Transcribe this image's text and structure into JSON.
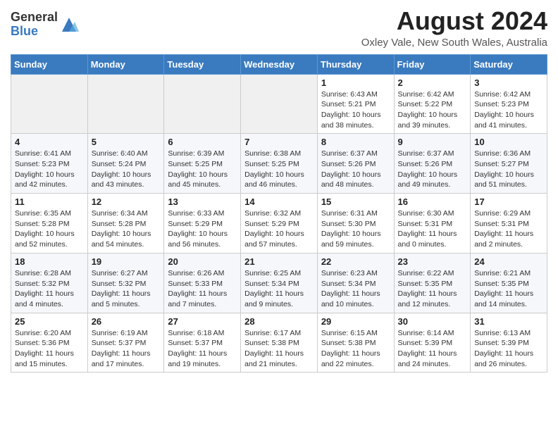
{
  "header": {
    "logo_general": "General",
    "logo_blue": "Blue",
    "month": "August 2024",
    "location": "Oxley Vale, New South Wales, Australia"
  },
  "weekdays": [
    "Sunday",
    "Monday",
    "Tuesday",
    "Wednesday",
    "Thursday",
    "Friday",
    "Saturday"
  ],
  "weeks": [
    [
      {
        "day": "",
        "info": ""
      },
      {
        "day": "",
        "info": ""
      },
      {
        "day": "",
        "info": ""
      },
      {
        "day": "",
        "info": ""
      },
      {
        "day": "1",
        "info": "Sunrise: 6:43 AM\nSunset: 5:21 PM\nDaylight: 10 hours\nand 38 minutes."
      },
      {
        "day": "2",
        "info": "Sunrise: 6:42 AM\nSunset: 5:22 PM\nDaylight: 10 hours\nand 39 minutes."
      },
      {
        "day": "3",
        "info": "Sunrise: 6:42 AM\nSunset: 5:23 PM\nDaylight: 10 hours\nand 41 minutes."
      }
    ],
    [
      {
        "day": "4",
        "info": "Sunrise: 6:41 AM\nSunset: 5:23 PM\nDaylight: 10 hours\nand 42 minutes."
      },
      {
        "day": "5",
        "info": "Sunrise: 6:40 AM\nSunset: 5:24 PM\nDaylight: 10 hours\nand 43 minutes."
      },
      {
        "day": "6",
        "info": "Sunrise: 6:39 AM\nSunset: 5:25 PM\nDaylight: 10 hours\nand 45 minutes."
      },
      {
        "day": "7",
        "info": "Sunrise: 6:38 AM\nSunset: 5:25 PM\nDaylight: 10 hours\nand 46 minutes."
      },
      {
        "day": "8",
        "info": "Sunrise: 6:37 AM\nSunset: 5:26 PM\nDaylight: 10 hours\nand 48 minutes."
      },
      {
        "day": "9",
        "info": "Sunrise: 6:37 AM\nSunset: 5:26 PM\nDaylight: 10 hours\nand 49 minutes."
      },
      {
        "day": "10",
        "info": "Sunrise: 6:36 AM\nSunset: 5:27 PM\nDaylight: 10 hours\nand 51 minutes."
      }
    ],
    [
      {
        "day": "11",
        "info": "Sunrise: 6:35 AM\nSunset: 5:28 PM\nDaylight: 10 hours\nand 52 minutes."
      },
      {
        "day": "12",
        "info": "Sunrise: 6:34 AM\nSunset: 5:28 PM\nDaylight: 10 hours\nand 54 minutes."
      },
      {
        "day": "13",
        "info": "Sunrise: 6:33 AM\nSunset: 5:29 PM\nDaylight: 10 hours\nand 56 minutes."
      },
      {
        "day": "14",
        "info": "Sunrise: 6:32 AM\nSunset: 5:29 PM\nDaylight: 10 hours\nand 57 minutes."
      },
      {
        "day": "15",
        "info": "Sunrise: 6:31 AM\nSunset: 5:30 PM\nDaylight: 10 hours\nand 59 minutes."
      },
      {
        "day": "16",
        "info": "Sunrise: 6:30 AM\nSunset: 5:31 PM\nDaylight: 11 hours\nand 0 minutes."
      },
      {
        "day": "17",
        "info": "Sunrise: 6:29 AM\nSunset: 5:31 PM\nDaylight: 11 hours\nand 2 minutes."
      }
    ],
    [
      {
        "day": "18",
        "info": "Sunrise: 6:28 AM\nSunset: 5:32 PM\nDaylight: 11 hours\nand 4 minutes."
      },
      {
        "day": "19",
        "info": "Sunrise: 6:27 AM\nSunset: 5:32 PM\nDaylight: 11 hours\nand 5 minutes."
      },
      {
        "day": "20",
        "info": "Sunrise: 6:26 AM\nSunset: 5:33 PM\nDaylight: 11 hours\nand 7 minutes."
      },
      {
        "day": "21",
        "info": "Sunrise: 6:25 AM\nSunset: 5:34 PM\nDaylight: 11 hours\nand 9 minutes."
      },
      {
        "day": "22",
        "info": "Sunrise: 6:23 AM\nSunset: 5:34 PM\nDaylight: 11 hours\nand 10 minutes."
      },
      {
        "day": "23",
        "info": "Sunrise: 6:22 AM\nSunset: 5:35 PM\nDaylight: 11 hours\nand 12 minutes."
      },
      {
        "day": "24",
        "info": "Sunrise: 6:21 AM\nSunset: 5:35 PM\nDaylight: 11 hours\nand 14 minutes."
      }
    ],
    [
      {
        "day": "25",
        "info": "Sunrise: 6:20 AM\nSunset: 5:36 PM\nDaylight: 11 hours\nand 15 minutes."
      },
      {
        "day": "26",
        "info": "Sunrise: 6:19 AM\nSunset: 5:37 PM\nDaylight: 11 hours\nand 17 minutes."
      },
      {
        "day": "27",
        "info": "Sunrise: 6:18 AM\nSunset: 5:37 PM\nDaylight: 11 hours\nand 19 minutes."
      },
      {
        "day": "28",
        "info": "Sunrise: 6:17 AM\nSunset: 5:38 PM\nDaylight: 11 hours\nand 21 minutes."
      },
      {
        "day": "29",
        "info": "Sunrise: 6:15 AM\nSunset: 5:38 PM\nDaylight: 11 hours\nand 22 minutes."
      },
      {
        "day": "30",
        "info": "Sunrise: 6:14 AM\nSunset: 5:39 PM\nDaylight: 11 hours\nand 24 minutes."
      },
      {
        "day": "31",
        "info": "Sunrise: 6:13 AM\nSunset: 5:39 PM\nDaylight: 11 hours\nand 26 minutes."
      }
    ]
  ]
}
